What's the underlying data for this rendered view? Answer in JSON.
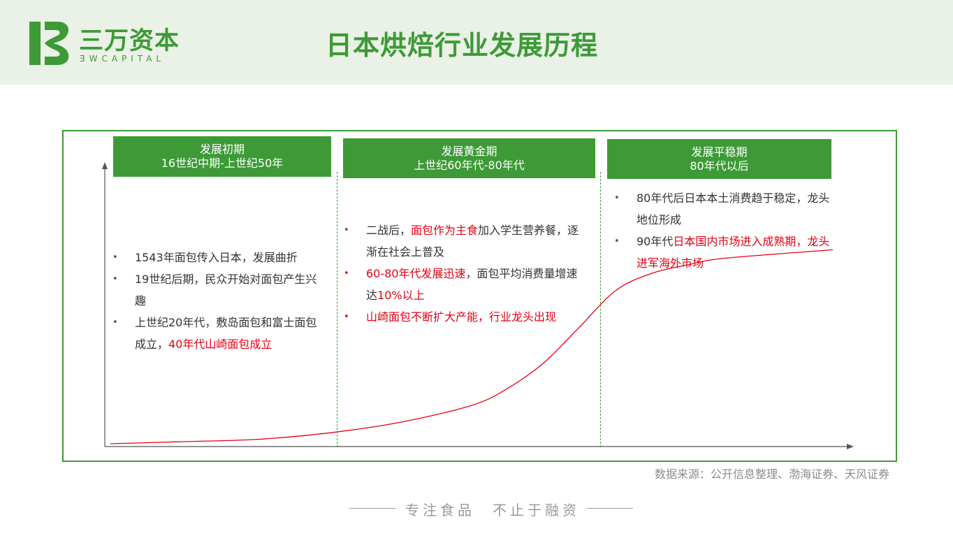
{
  "logo": {
    "name_cn": "三万资本",
    "name_en": "ƎWCAPITAL",
    "brand_color": "#3d9a37"
  },
  "title": "日本烘焙行业发展历程",
  "highlight_color": "#e60012",
  "phases": [
    {
      "name": "发展初期",
      "period": "16世纪中期-上世纪50年",
      "bullets": [
        {
          "segments": [
            {
              "text": "1543年面包传入日本，发展曲折",
              "highlight": false
            }
          ]
        },
        {
          "segments": [
            {
              "text": "19世纪后期，民众开始对面包产生兴趣",
              "highlight": false
            }
          ]
        },
        {
          "segments": [
            {
              "text": "上世纪20年代，敷岛面包和富士面包成立，",
              "highlight": false
            },
            {
              "text": "40年代山崎面包成立",
              "highlight": true
            }
          ]
        }
      ]
    },
    {
      "name": "发展黄金期",
      "period": "上世纪60年代-80年代",
      "bullets": [
        {
          "segments": [
            {
              "text": "二战后，",
              "highlight": false
            },
            {
              "text": "面包作为主食",
              "highlight": true
            },
            {
              "text": "加入学生营养餐，逐渐在社会上普及",
              "highlight": false
            }
          ]
        },
        {
          "red_bullet": true,
          "segments": [
            {
              "text": "60-80年代发展迅速",
              "highlight": true
            },
            {
              "text": "，面包平均消费量增速达",
              "highlight": false
            },
            {
              "text": "10%以上",
              "highlight": true
            }
          ]
        },
        {
          "red_bullet": true,
          "segments": [
            {
              "text": "山崎面包不断扩大产能，行业龙头出现",
              "highlight": true
            }
          ]
        }
      ]
    },
    {
      "name": "发展平稳期",
      "period": "80年代以后",
      "bullets": [
        {
          "segments": [
            {
              "text": "80年代后日本本土消费趋于稳定，龙头地位形成",
              "highlight": false
            }
          ]
        },
        {
          "segments": [
            {
              "text": "90年代",
              "highlight": false
            },
            {
              "text": "日本国内市场进入成熟期，龙头进军海外市场",
              "highlight": true
            }
          ]
        }
      ]
    }
  ],
  "chart_data": {
    "type": "line",
    "title": "",
    "xlabel": "",
    "ylabel": "",
    "grid": false,
    "x": [
      0,
      0.1,
      0.2,
      0.3,
      0.4,
      0.5,
      0.55,
      0.6,
      0.65,
      0.7,
      0.75,
      0.8,
      0.85,
      1.0
    ],
    "series": [
      {
        "color": "#e60012",
        "values": [
          0.0,
          0.01,
          0.02,
          0.05,
          0.1,
          0.18,
          0.26,
          0.38,
          0.55,
          0.72,
          0.8,
          0.84,
          0.87,
          0.91
        ]
      }
    ]
  },
  "source": "数据来源：公开信息整理、渤海证券、天风证券",
  "footer": "专注食品　不止于融资"
}
